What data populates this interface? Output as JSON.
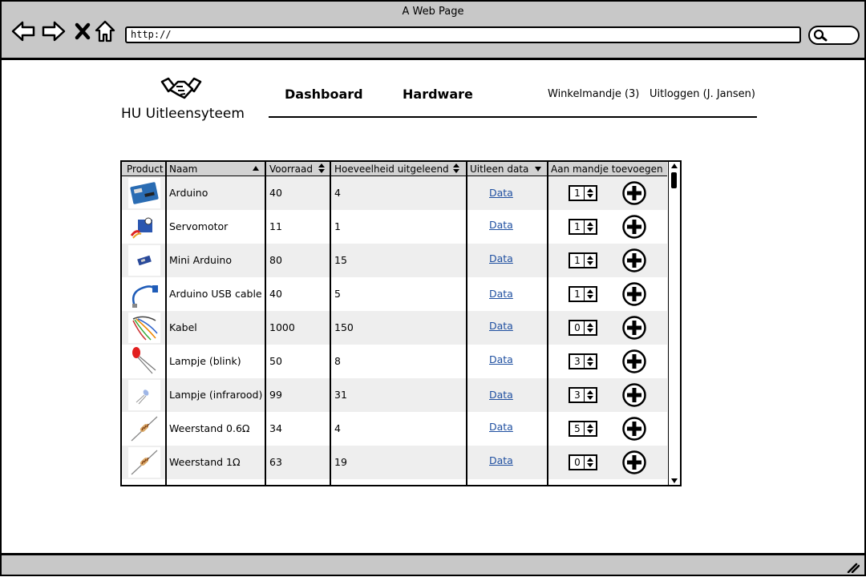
{
  "browser": {
    "window_title": "A Web Page",
    "url": "http://"
  },
  "header": {
    "logo_text": "HU Uitleensyteem",
    "nav": [
      {
        "label": "Dashboard"
      },
      {
        "label": "Hardware"
      }
    ],
    "cart_label": "Winkelmandje (3)",
    "logout_label": "Uitloggen (J. Jansen)"
  },
  "table": {
    "columns": {
      "product": "Product",
      "name": "Naam",
      "stock": "Voorraad",
      "lent": "Hoeveelheid uitgeleend",
      "dates": "Uitleen data",
      "add": "Aan mandje toevoegen"
    },
    "rows": [
      {
        "name": "Arduino",
        "stock": "40",
        "lent": "4",
        "link": "Data",
        "qty": "1",
        "icon": "arduino-board-icon"
      },
      {
        "name": "Servomotor",
        "stock": "11",
        "lent": "1",
        "link": "Data",
        "qty": "1",
        "icon": "servomotor-icon"
      },
      {
        "name": "Mini Arduino",
        "stock": "80",
        "lent": "15",
        "link": "Data",
        "qty": "1",
        "icon": "mini-arduino-icon"
      },
      {
        "name": "Arduino USB cable",
        "stock": "40",
        "lent": "5",
        "link": "Data",
        "qty": "1",
        "icon": "usb-cable-icon"
      },
      {
        "name": "Kabel",
        "stock": "1000",
        "lent": "150",
        "link": "Data",
        "qty": "0",
        "icon": "jumper-wires-icon"
      },
      {
        "name": "Lampje (blink)",
        "stock": "50",
        "lent": "8",
        "link": "Data",
        "qty": "3",
        "icon": "red-led-icon"
      },
      {
        "name": "Lampje (infrarood)",
        "stock": "99",
        "lent": "31",
        "link": "Data",
        "qty": "3",
        "icon": "infrared-led-icon"
      },
      {
        "name": "Weerstand 0.6Ω",
        "stock": "34",
        "lent": "4",
        "link": "Data",
        "qty": "5",
        "icon": "resistor-icon"
      },
      {
        "name": "Weerstand 1Ω",
        "stock": "63",
        "lent": "19",
        "link": "Data",
        "qty": "0",
        "icon": "resistor-icon"
      }
    ]
  },
  "colors": {
    "chrome": "#c8c8c8",
    "header_row": "#d2d2d2",
    "alt_row": "#eeeeee",
    "link": "#1f4fa0"
  }
}
